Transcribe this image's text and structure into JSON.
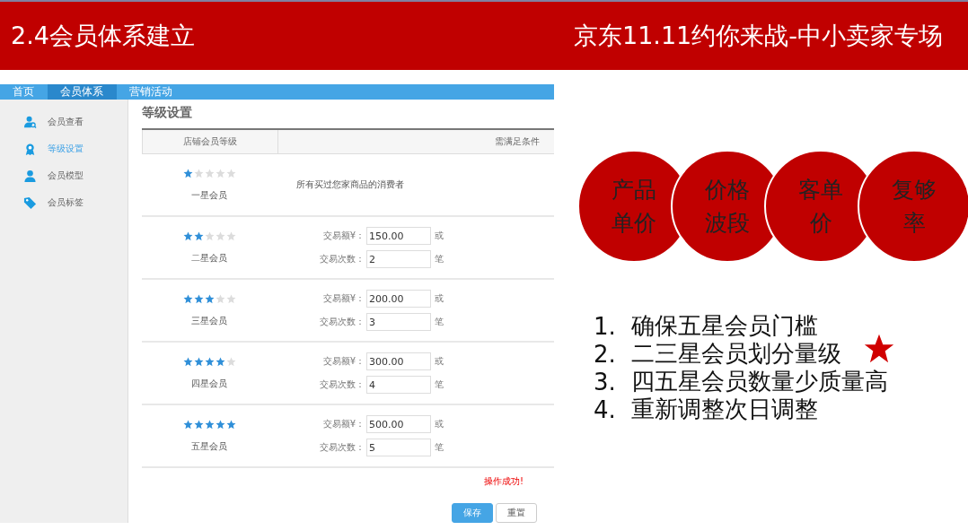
{
  "header": {
    "title": "2.4会员体系建立",
    "subtitle": "京东11.11约你来战-中小卖家专场"
  },
  "app": {
    "nav": [
      {
        "label": "首页",
        "selected": false
      },
      {
        "label": "会员体系",
        "selected": true
      },
      {
        "label": "营销活动",
        "selected": false
      }
    ],
    "sidebar": [
      {
        "label": "会员查看",
        "selected": false
      },
      {
        "label": "等级设置",
        "selected": true
      },
      {
        "label": "会员模型",
        "selected": false
      },
      {
        "label": "会员标签",
        "selected": false
      }
    ],
    "page_title": "等级设置",
    "columns": [
      "店铺会员等级",
      "需满足条件"
    ],
    "rows": [
      {
        "kind": "text",
        "stars": 1,
        "name": "一星会员",
        "condition": "所有买过您家商品的消费者"
      },
      {
        "kind": "inputs",
        "stars": 2,
        "name": "二星会员",
        "amount_label": "交易额¥：",
        "amount": "150.00",
        "amount_unit": "或",
        "count_label": "交易次数：",
        "count": "2",
        "count_unit": "笔"
      },
      {
        "kind": "inputs",
        "stars": 3,
        "name": "三星会员",
        "amount_label": "交易额¥：",
        "amount": "200.00",
        "amount_unit": "或",
        "count_label": "交易次数：",
        "count": "3",
        "count_unit": "笔"
      },
      {
        "kind": "inputs",
        "stars": 4,
        "name": "四星会员",
        "amount_label": "交易额¥：",
        "amount": "300.00",
        "amount_unit": "或",
        "count_label": "交易次数：",
        "count": "4",
        "count_unit": "笔"
      },
      {
        "kind": "inputs",
        "stars": 5,
        "name": "五星会员",
        "amount_label": "交易额¥：",
        "amount": "500.00",
        "amount_unit": "或",
        "count_label": "交易次数：",
        "count": "5",
        "count_unit": "笔"
      }
    ],
    "message": "操作成功!",
    "buttons": [
      {
        "label": "保存",
        "kind": "primary"
      },
      {
        "label": "重置",
        "kind": "default"
      }
    ]
  },
  "circles": [
    "产品单价",
    "价格波段",
    "客单价",
    "复够率"
  ],
  "points": [
    {
      "number": "1.",
      "text": "确保五星会员门槛"
    },
    {
      "number": "2.",
      "text": "二三星会员划分量级"
    },
    {
      "number": "3.",
      "text": "四五星会员数量少质量高"
    },
    {
      "number": "4.",
      "text": "重新调整次日调整"
    }
  ]
}
